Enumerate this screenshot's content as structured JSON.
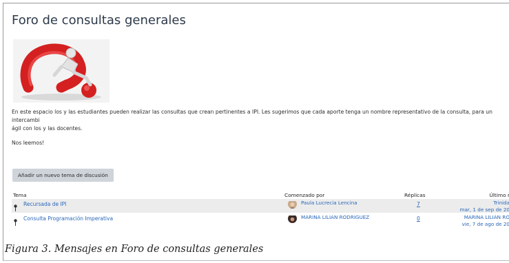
{
  "forum": {
    "title": "Foro de consultas generales",
    "intro_line1": "En este espacio los y las estudiantes pueden realizar las consultas que crean pertinentes a IPI. Les sugerimos que cada aporte tenga un nombre representativo de la consulta, para un intercambi",
    "intro_line2": "ágil con los y las docentes.",
    "closing": "Nos leemos!",
    "add_button": "Añadir un nuevo tema de discusión"
  },
  "table": {
    "headers": {
      "topic": "Tema",
      "started_by": "Comenzado por",
      "replies": "Réplicas",
      "last_post": "Último r"
    },
    "rows": [
      {
        "topic": "Recursada de IPI",
        "author": "Paula Lucrecia Lencina",
        "replies": "7",
        "last_author": "Trinida",
        "last_date": "mar, 1 de sep de 20"
      },
      {
        "topic": "Consulta Programación Imperativa",
        "author": "MARINA LILIAN RODRIGUEZ",
        "replies": "0",
        "last_author": "MARINA LILIAN RO",
        "last_date": "vie, 7 de ago de 20"
      }
    ]
  },
  "caption": "Figura 3. Mensajes en Foro de consultas generales",
  "icons": {
    "pin": "pin-icon",
    "hero": "question-mark-illustration"
  },
  "colors": {
    "link": "#2a67b8",
    "button_bg": "#ced4da",
    "row_shade": "#ececec",
    "title": "#2d3a4a"
  }
}
